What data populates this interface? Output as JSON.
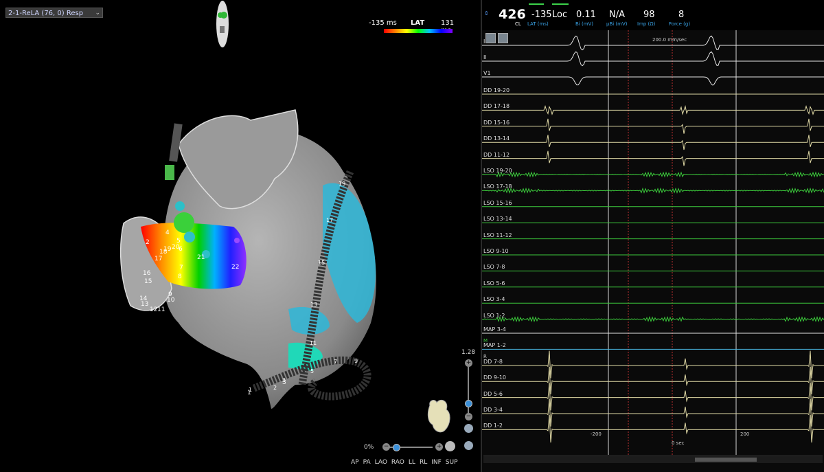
{
  "map_selector": {
    "label": "2-1-ReLA (76, 0) Resp"
  },
  "lat_legend": {
    "min": "-135 ms",
    "title": "LAT",
    "max": "131 ms"
  },
  "view_buttons": [
    "AP",
    "PA",
    "LAO",
    "RAO",
    "LL",
    "RL",
    "INF",
    "SUP"
  ],
  "controls": {
    "opacity": "0%",
    "zoom": "1.28",
    "plus": "+",
    "minus": "−"
  },
  "electrode_labels": [
    "1",
    "2",
    "3",
    "4",
    "5",
    "6",
    "7",
    "8",
    "9",
    "10",
    "11",
    "12",
    "13",
    "14",
    "15",
    "16",
    "17",
    "18",
    "19",
    "20",
    "21",
    "22"
  ],
  "catheter_labels": [
    "1",
    "2",
    "3",
    "5",
    "7",
    "9",
    "11",
    "13",
    "15",
    "17",
    "19"
  ],
  "header": {
    "cl_value": "426",
    "cl_label": "CL",
    "lat_value": "-135",
    "lat_label": "LAT (ms)",
    "loc_value": "Loc",
    "bi_value": "0.11",
    "bi_label": "Bi (mV)",
    "ubi_value": "N/A",
    "ubi_label": "µBi (mV)",
    "imp_value": "98",
    "imp_label": "Imp (Ω)",
    "force_value": "8",
    "force_label": "Force (g)"
  },
  "sweep_speed": "200.0 mm/sec",
  "axis": {
    "left": "-200",
    "center": "0 sec",
    "right": "200"
  },
  "traces": [
    {
      "label": "I",
      "color": "#e6e6e6",
      "kind": "ecg"
    },
    {
      "label": "II",
      "color": "#e6e6e6",
      "kind": "ecg"
    },
    {
      "label": "V1",
      "color": "#e6e6e6",
      "kind": "ecgneg"
    },
    {
      "label": "DD 19-20",
      "color": "#e0d9a6",
      "kind": "flat"
    },
    {
      "label": "DD 17-18",
      "color": "#e0d9a6",
      "kind": "small"
    },
    {
      "label": "DD 15-16",
      "color": "#e0d9a6",
      "kind": "spike"
    },
    {
      "label": "DD 13-14",
      "color": "#e0d9a6",
      "kind": "spike"
    },
    {
      "label": "DD 11-12",
      "color": "#e0d9a6",
      "kind": "spike"
    },
    {
      "label": "LSO 19-20",
      "color": "#3ccb3c",
      "kind": "noisy"
    },
    {
      "label": "LSO 17-18",
      "color": "#3ccb3c",
      "kind": "noisy"
    },
    {
      "label": "LSO 15-16",
      "color": "#3ccb3c",
      "kind": "flat"
    },
    {
      "label": "LSO 13-14",
      "color": "#3ccb3c",
      "kind": "flat"
    },
    {
      "label": "LSO 11-12",
      "color": "#3ccb3c",
      "kind": "flat"
    },
    {
      "label": "LSO 9-10",
      "color": "#3ccb3c",
      "kind": "flat"
    },
    {
      "label": "LSO 7-8",
      "color": "#3ccb3c",
      "kind": "flat"
    },
    {
      "label": "LSO 5-6",
      "color": "#3ccb3c",
      "kind": "flat"
    },
    {
      "label": "LSO 3-4",
      "color": "#3ccb3c",
      "kind": "flat"
    },
    {
      "label": "LSO 1-2",
      "color": "#3ccb3c",
      "kind": "noisy"
    },
    {
      "label": "MAP 3-4",
      "color": "#e6e6e6",
      "kind": "flat"
    },
    {
      "label": "MAP 1-2",
      "color": "#48b6e0",
      "kind": "flat"
    },
    {
      "label": "DD 7-8",
      "color": "#e0d9a6",
      "kind": "big"
    },
    {
      "label": "DD 9-10",
      "color": "#e0d9a6",
      "kind": "big"
    },
    {
      "label": "DD 5-6",
      "color": "#e0d9a6",
      "kind": "big"
    },
    {
      "label": "DD 3-4",
      "color": "#e0d9a6",
      "kind": "big"
    },
    {
      "label": "DD 1-2",
      "color": "#e0d9a6",
      "kind": "big"
    }
  ],
  "map_markers": {
    "m": "M",
    "r": "R"
  }
}
